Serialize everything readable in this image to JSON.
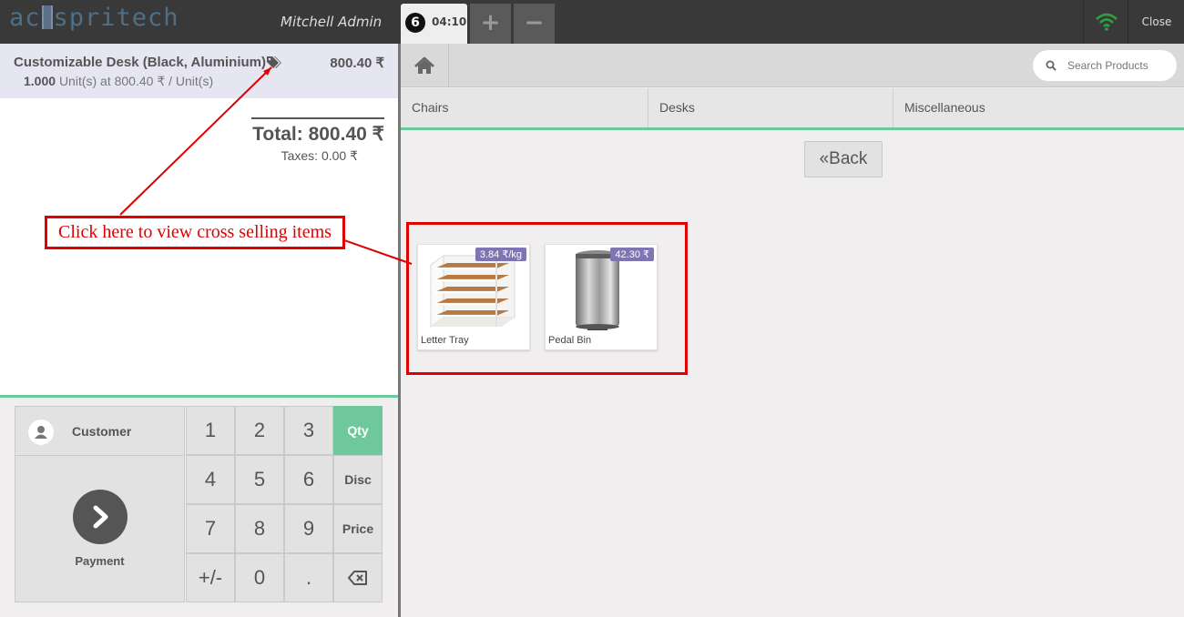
{
  "topbar": {
    "logo_pre": "ac",
    "logo_post": "spritech",
    "cashier": "Mitchell Admin",
    "order": {
      "number": "6",
      "time": "04:10"
    },
    "add_label": "+",
    "remove_label": "−",
    "close_label": "Close"
  },
  "order": {
    "line": {
      "name": "Customizable Desk (Black, Aluminium)",
      "price": "800.40 ₹",
      "qty": "1.000",
      "unit_info": "Unit(s) at 800.40 ₹ / Unit(s)"
    },
    "total": "Total: 800.40 ₹",
    "taxes": "Taxes: 0.00 ₹"
  },
  "actionpad": {
    "customer_label": "Customer",
    "payment_label": "Payment"
  },
  "numpad": {
    "keys": [
      "1",
      "2",
      "3",
      "Qty",
      "4",
      "5",
      "6",
      "Disc",
      "7",
      "8",
      "9",
      "Price",
      "+/-",
      "0",
      "."
    ],
    "active_mode": "Qty"
  },
  "products_screen": {
    "search_placeholder": "Search Products",
    "categories": [
      "Chairs",
      "Desks",
      "Miscellaneous"
    ],
    "back_label": "Back",
    "products": [
      {
        "name": "Letter Tray",
        "price": "3.84 ₹/kg"
      },
      {
        "name": "Pedal Bin",
        "price": "42.30 ₹"
      }
    ]
  },
  "annotation": {
    "text": "Click here to view cross selling items",
    "color": "#e00000"
  },
  "colors": {
    "accent": "#6ec89b",
    "price_tag": "#7f75b3",
    "topbar": "#393939",
    "wifi": "#2ea043"
  }
}
